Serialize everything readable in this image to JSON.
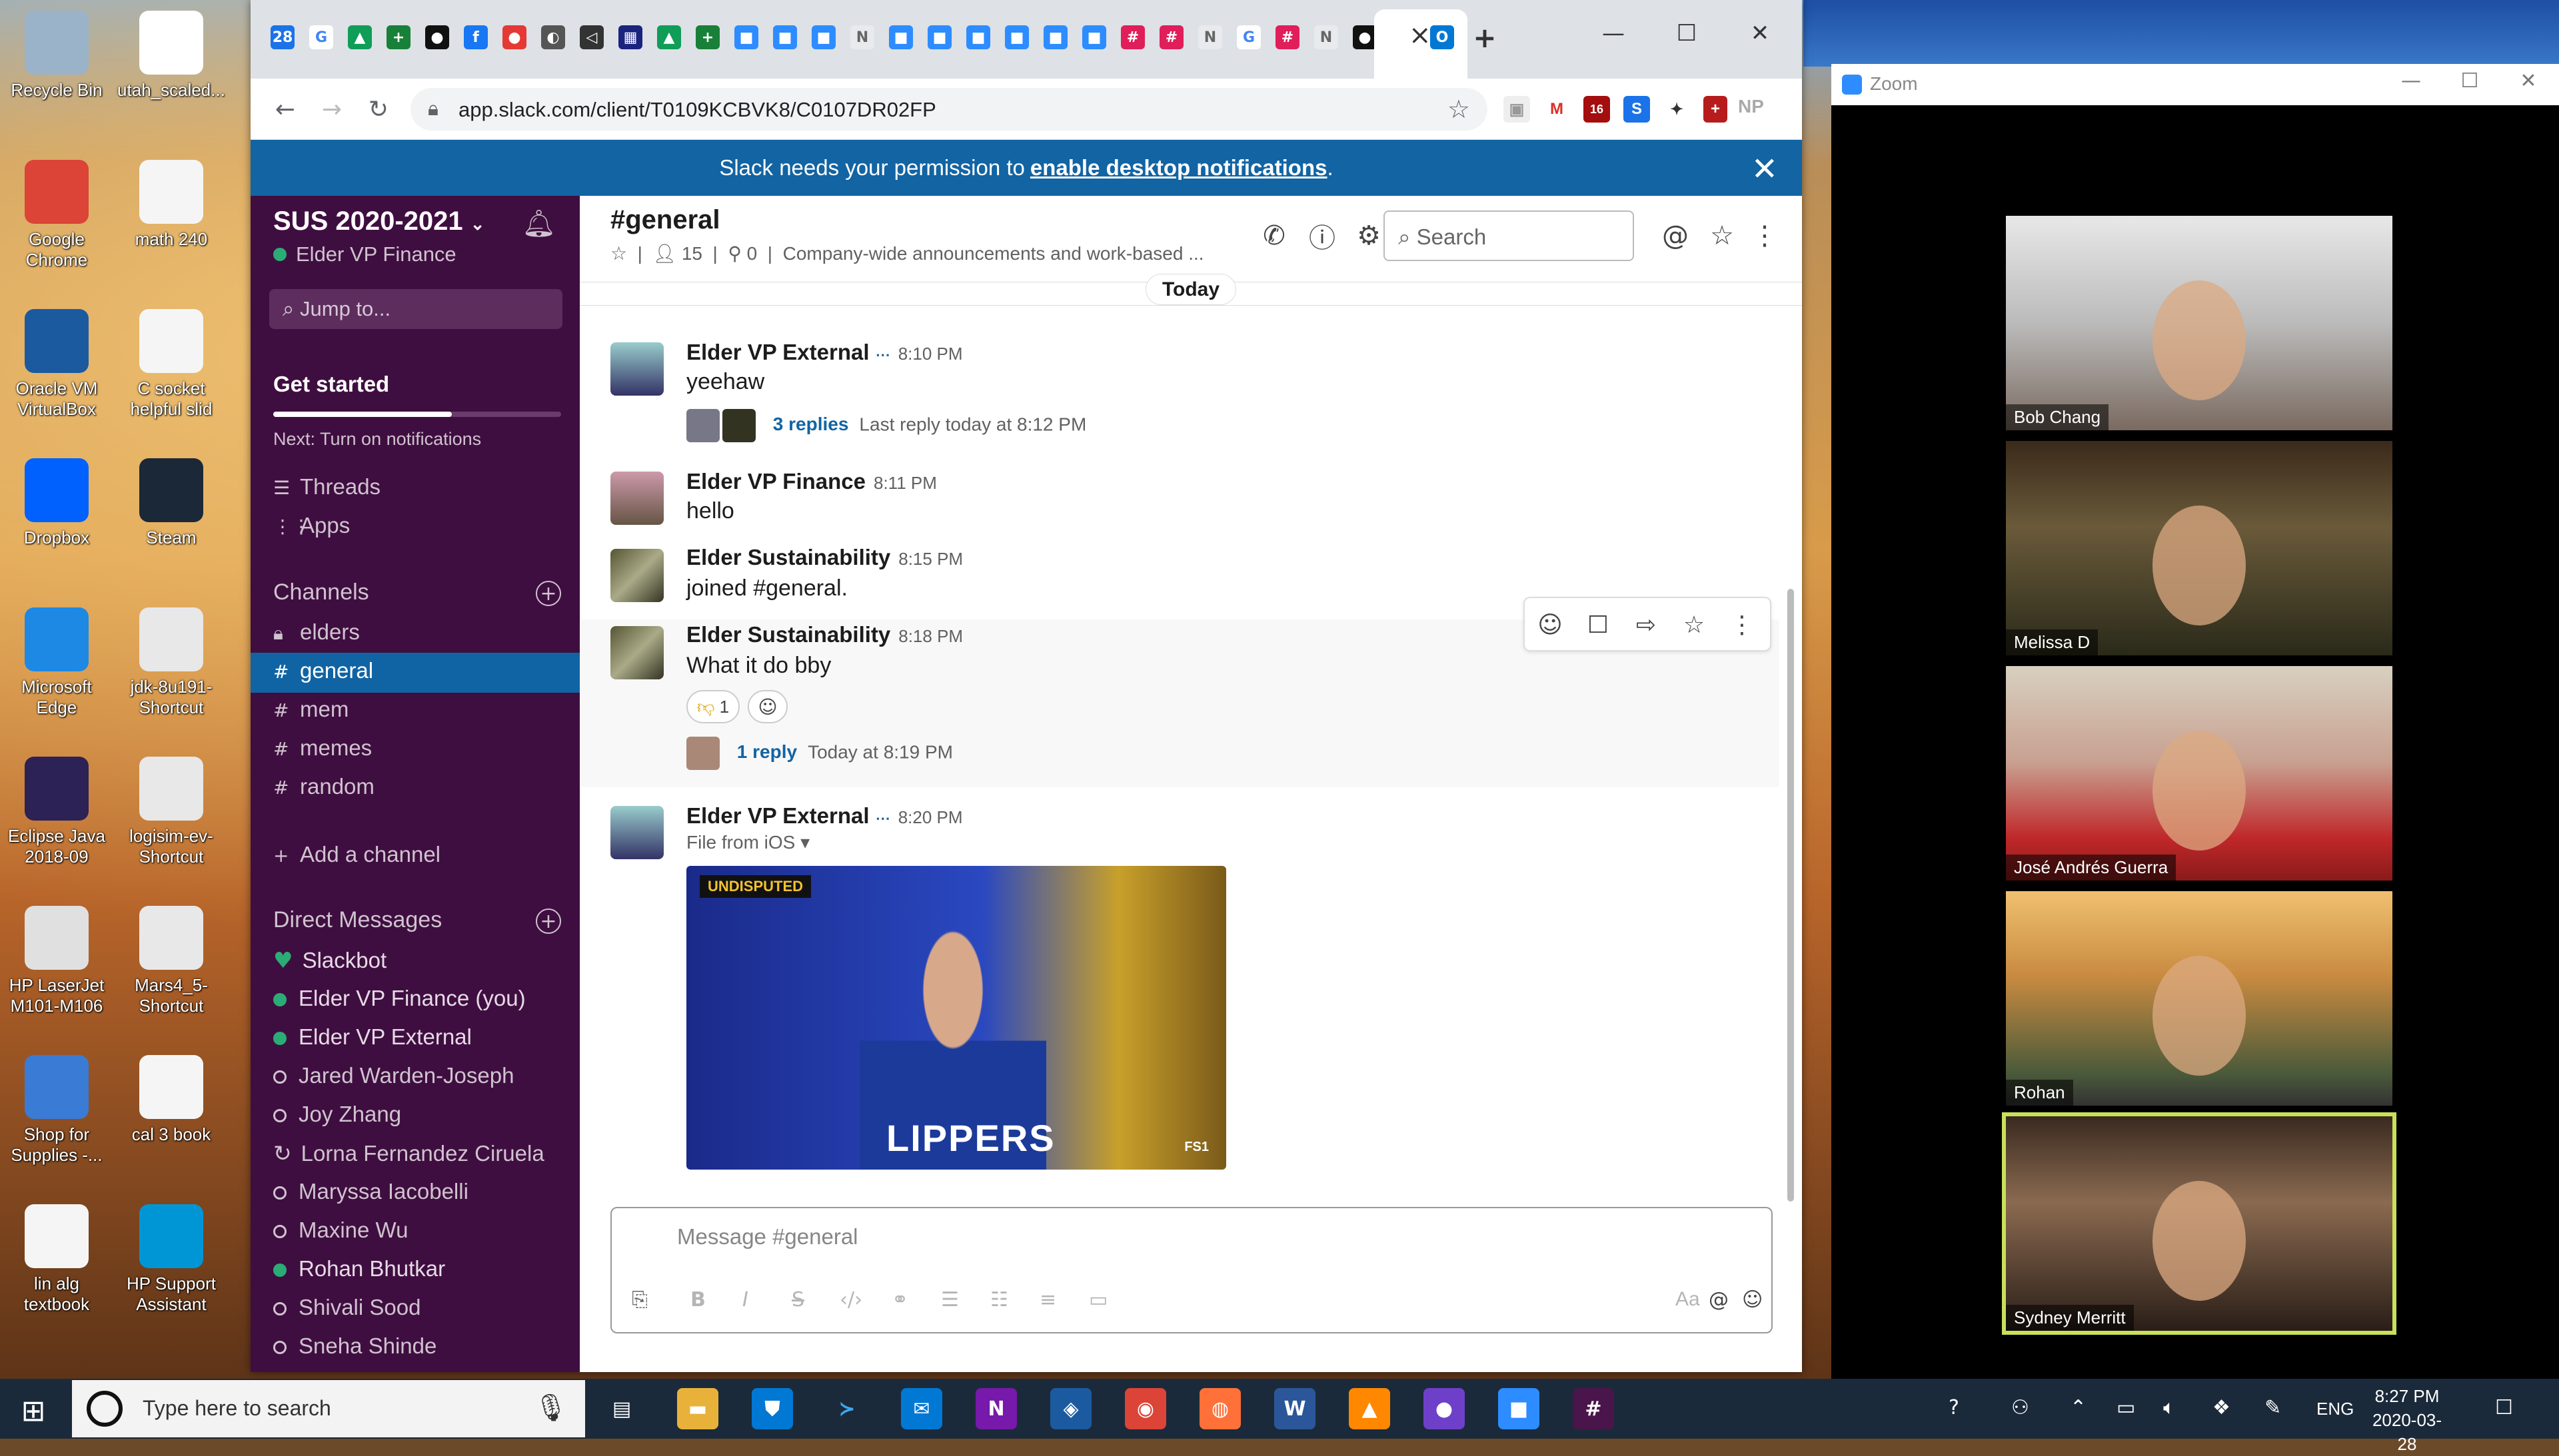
{
  "desktop": {
    "col1": [
      {
        "label": "Recycle Bin",
        "icon": "recycle-bin-icon",
        "color": "#9ab3c8"
      },
      {
        "label": "Google Chrome",
        "icon": "chrome-icon",
        "color": "#db4437"
      },
      {
        "label": "Oracle VM VirtualBox",
        "icon": "virtualbox-icon",
        "color": "#1c5aa0"
      },
      {
        "label": "Dropbox",
        "icon": "dropbox-icon",
        "color": "#0061fe"
      },
      {
        "label": "Microsoft Edge",
        "icon": "edge-icon",
        "color": "#1e88e5"
      },
      {
        "label": "Eclipse Java 2018-09",
        "icon": "eclipse-icon",
        "color": "#2c2255"
      },
      {
        "label": "HP LaserJet M101-M106",
        "icon": "printer-icon",
        "color": "#e0e0e0"
      },
      {
        "label": "Shop for Supplies -...",
        "icon": "printer-supplies-icon",
        "color": "#3a7bd5"
      },
      {
        "label": "lin alg textbook",
        "icon": "pdf-icon",
        "color": "#f5f5f5"
      }
    ],
    "col2": [
      {
        "label": "utah_scaled...",
        "icon": "file-icon",
        "color": "#ffffff"
      },
      {
        "label": "math 240",
        "icon": "pdf-icon",
        "color": "#f5f5f5"
      },
      {
        "label": "C socket helpful slid",
        "icon": "pdf-icon",
        "color": "#f5f5f5"
      },
      {
        "label": "Steam",
        "icon": "steam-icon",
        "color": "#1b2838"
      },
      {
        "label": "jdk-8u191-Shortcut",
        "icon": "java-icon",
        "color": "#e8e8e8"
      },
      {
        "label": "logisim-ev-Shortcut",
        "icon": "java-icon",
        "color": "#e8e8e8"
      },
      {
        "label": "Mars4_5-Shortcut",
        "icon": "java-icon",
        "color": "#e8e8e8"
      },
      {
        "label": "cal 3 book",
        "icon": "pdf-icon",
        "color": "#f5f5f5"
      },
      {
        "label": "HP Support Assistant",
        "icon": "help-icon",
        "color": "#0096d6"
      }
    ]
  },
  "browser": {
    "url": "app.slack.com/client/T0109KCBVK8/C0107DR02FP",
    "tab_close": "×",
    "new_tab": "+",
    "avatar_letter": "M",
    "ext_badge": "16",
    "ext_np": "NP"
  },
  "banner": {
    "prefix": "Slack needs your permission to",
    "link": "enable desktop notifications",
    "suffix": "."
  },
  "sidebar": {
    "workspace": "SUS 2020-2021",
    "user": "Elder VP Finance",
    "jump": "Jump to...",
    "get_started": "Get started",
    "get_started_progress": 0.62,
    "next": "Next: Turn on notifications",
    "threads": "Threads",
    "apps": "Apps",
    "channels_header": "Channels",
    "channels": [
      "elders",
      "general",
      "mem",
      "memes",
      "random"
    ],
    "add_channel": "Add a channel",
    "dm_header": "Direct Messages",
    "dms": [
      {
        "name": "Slackbot",
        "status": "heart"
      },
      {
        "name": "Elder VP Finance",
        "suffix": "(you)",
        "status": "on"
      },
      {
        "name": "Elder VP External",
        "status": "on"
      },
      {
        "name": "Jared Warden-Joseph",
        "status": "off"
      },
      {
        "name": "Joy Zhang",
        "status": "off"
      },
      {
        "name": "Lorna Fernandez Ciruela",
        "status": "away"
      },
      {
        "name": "Maryssa Iacobelli",
        "status": "off"
      },
      {
        "name": "Maxine Wu",
        "status": "off"
      },
      {
        "name": "Rohan Bhutkar",
        "status": "on"
      },
      {
        "name": "Shivali Sood",
        "status": "off"
      },
      {
        "name": "Sneha Shinde",
        "status": "off"
      }
    ]
  },
  "channel": {
    "name": "#general",
    "members": "15",
    "pins": "0",
    "description": "Company-wide announcements and work-based ...",
    "search_placeholder": "Search",
    "today": "Today"
  },
  "messages": [
    {
      "author": "Elder VP External",
      "time": "8:10 PM",
      "text": "yeehaw",
      "replies": "3 replies",
      "last_reply": "Last reply today at 8:12 PM"
    },
    {
      "author": "Elder VP Finance",
      "time": "8:11 PM",
      "text": "hello"
    },
    {
      "author": "Elder Sustainability",
      "time": "8:15 PM",
      "text": "joined #general."
    },
    {
      "author": "Elder Sustainability",
      "time": "8:18 PM",
      "text": "What it do bby",
      "reaction_count": "1",
      "replies": "1 reply",
      "last_reply": "Today at 8:19 PM"
    },
    {
      "author": "Elder VP External",
      "time": "8:20 PM",
      "file_label": "File from iOS",
      "gif_tag": "UNDISPUTED",
      "gif_jersey": "LIPPERS",
      "gif_brand": "FS1"
    }
  ],
  "composer": {
    "placeholder": "Message #general",
    "aa": "Aa"
  },
  "zoom": {
    "title": "Zoom",
    "participants": [
      "Bob Chang",
      "Melissa D",
      "José Andrés Guerra",
      "Rohan",
      "Sydney Merritt"
    ]
  },
  "taskbar": {
    "search_placeholder": "Type here to search",
    "lang": "ENG",
    "time": "8:27 PM",
    "date": "2020-03-28"
  }
}
